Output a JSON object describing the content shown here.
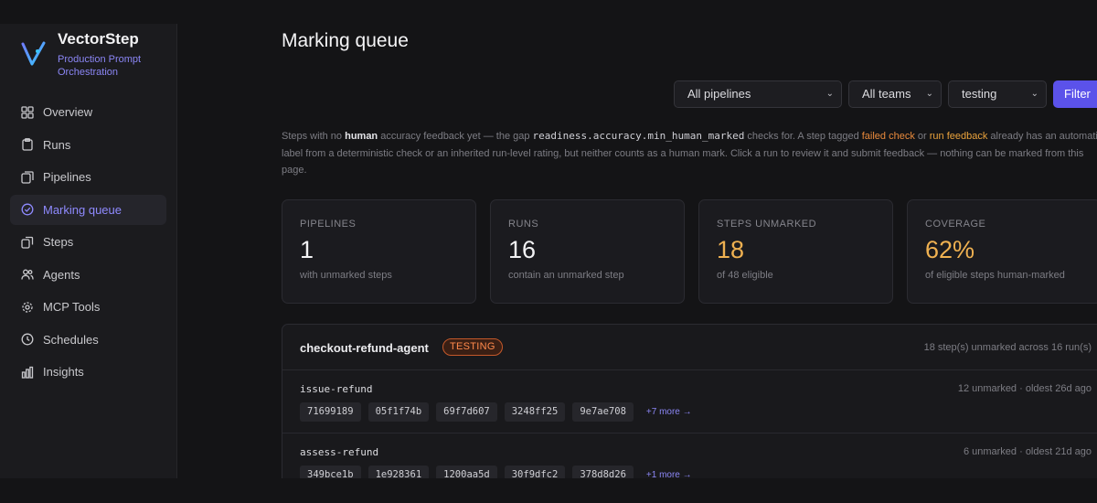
{
  "brand": {
    "name": "VectorStep",
    "subtitle": "Production Prompt Orchestration",
    "accent": "#8b86f5"
  },
  "nav": [
    {
      "label": "Overview",
      "icon": "grid-icon",
      "active": false
    },
    {
      "label": "Runs",
      "icon": "clipboard-icon",
      "active": false
    },
    {
      "label": "Pipelines",
      "icon": "layers-icon",
      "active": false
    },
    {
      "label": "Marking queue",
      "icon": "check-circle-icon",
      "active": true
    },
    {
      "label": "Steps",
      "icon": "copy-icon",
      "active": false
    },
    {
      "label": "Agents",
      "icon": "users-icon",
      "active": false
    },
    {
      "label": "MCP Tools",
      "icon": "gear-icon",
      "active": false
    },
    {
      "label": "Schedules",
      "icon": "clock-icon",
      "active": false
    },
    {
      "label": "Insights",
      "icon": "bar-chart-icon",
      "active": false
    }
  ],
  "page": {
    "title": "Marking queue"
  },
  "filters": {
    "pipeline": "All pipelines",
    "team": "All teams",
    "stage": "testing",
    "button": "Filter"
  },
  "description": {
    "p1": "Steps with no ",
    "human": "human",
    "p2": " accuracy feedback yet — the gap ",
    "code": "readiness.accuracy.min_human_marked",
    "p3": " checks for. A step tagged ",
    "failed_check": "failed check",
    "p4": " or ",
    "run_feedback": "run feedback",
    "p5": " already has an automatic label from a deterministic check or an inherited run-level rating, but neither counts as a human mark. Click a run to review it and submit feedback — nothing can be marked from this page."
  },
  "stats": [
    {
      "label": "PIPELINES",
      "value": "1",
      "sub": "with unmarked steps"
    },
    {
      "label": "RUNS",
      "value": "16",
      "sub": "contain an unmarked step"
    },
    {
      "label": "STEPS UNMARKED",
      "value": "18",
      "sub": "of 48 eligible"
    },
    {
      "label": "COVERAGE",
      "value": "62%",
      "sub": "of eligible steps human-marked"
    }
  ],
  "group": {
    "name": "checkout-refund-agent",
    "badge": "TESTING",
    "meta": "18 step(s) unmarked across 16 run(s)",
    "steps": [
      {
        "name": "issue-refund",
        "meta": "12 unmarked · oldest 26d ago",
        "runs": [
          "71699189",
          "05f1f74b",
          "69f7d607",
          "3248ff25",
          "9e7ae708"
        ],
        "more": "+7 more →"
      },
      {
        "name": "assess-refund",
        "meta": "6 unmarked · oldest 21d ago",
        "runs": [
          "349bce1b",
          "1e928361",
          "1200aa5d",
          "30f9dfc2",
          "378d8d26"
        ],
        "more": "+1 more →"
      }
    ]
  }
}
